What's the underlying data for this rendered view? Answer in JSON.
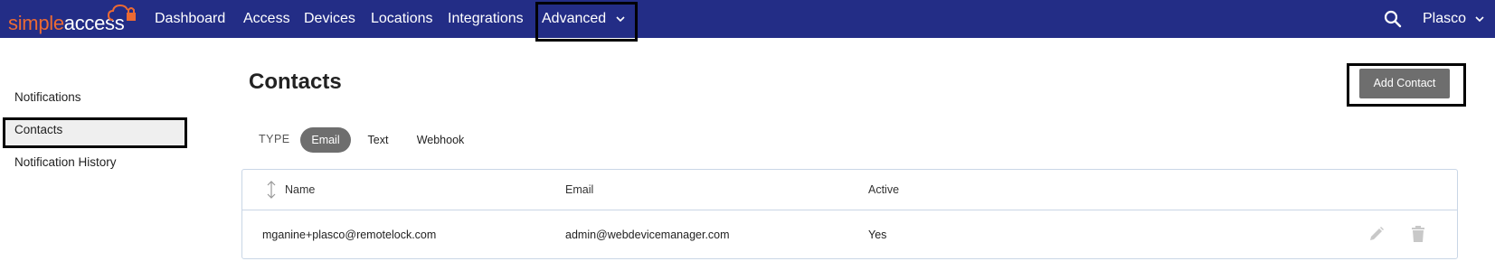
{
  "brand": {
    "simple": "simple",
    "access": "access",
    "simple_color": "#ec6a33",
    "nav_color": "#232d86"
  },
  "nav": {
    "items": [
      "Dashboard",
      "Access",
      "Devices",
      "Locations",
      "Integrations",
      "Advanced"
    ],
    "user": "Plasco"
  },
  "sidebar": {
    "items": [
      "Notifications",
      "Contacts",
      "Notification History"
    ],
    "active": "Contacts"
  },
  "main": {
    "title": "Contacts",
    "add_button": "Add Contact",
    "type_label": "TYPE",
    "type_filters": [
      "Email",
      "Text",
      "Webhook"
    ],
    "active_filter": "Email"
  },
  "table": {
    "columns": [
      "Name",
      "Email",
      "Active"
    ],
    "rows": [
      {
        "name": "mganine+plasco@remotelock.com",
        "email": "admin@webdevicemanager.com",
        "active": "Yes"
      }
    ]
  },
  "icons": [
    "cloud-lock-icon",
    "chevron-down-icon",
    "search-icon",
    "sort-icon",
    "edit-icon",
    "delete-icon"
  ]
}
